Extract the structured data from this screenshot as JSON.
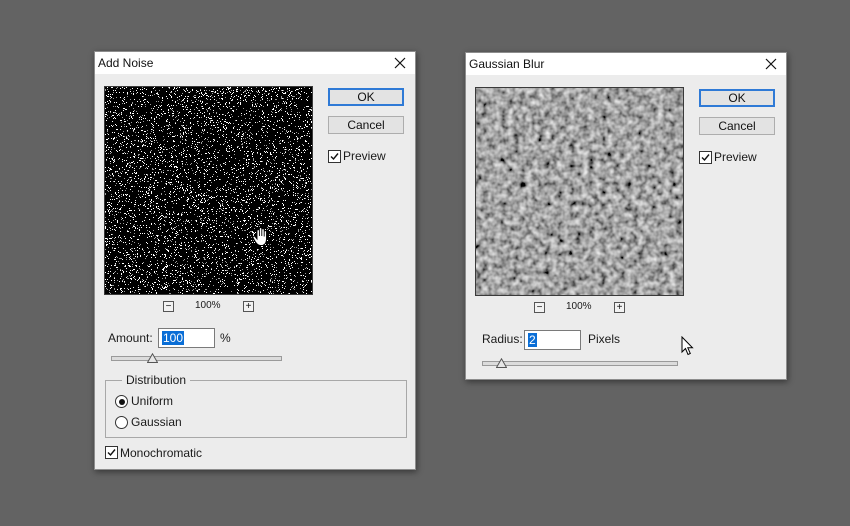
{
  "add_noise": {
    "title": "Add Noise",
    "ok_label": "OK",
    "cancel_label": "Cancel",
    "preview_label": "Preview",
    "preview_checked": true,
    "zoom_label": "100%",
    "zoom_minus": "−",
    "zoom_plus": "+",
    "amount_label": "Amount:",
    "amount_value": "100",
    "amount_unit": "%",
    "amount_slider_fraction": 0.25,
    "distribution_title": "Distribution",
    "distribution_options": [
      "Uniform",
      "Gaussian"
    ],
    "distribution_selected": "Uniform",
    "monochromatic_label": "Monochromatic",
    "monochromatic_checked": true
  },
  "gaussian_blur": {
    "title": "Gaussian Blur",
    "ok_label": "OK",
    "cancel_label": "Cancel",
    "preview_label": "Preview",
    "preview_checked": true,
    "zoom_label": "100%",
    "zoom_minus": "−",
    "zoom_plus": "+",
    "radius_label": "Radius:",
    "radius_value": "2",
    "radius_unit": "Pixels",
    "radius_slider_fraction": 0.1
  },
  "colors": {
    "desktop": "#636363",
    "dialog_bg": "#ececec",
    "default_button_border": "#2f7ad6",
    "selection": "#0a6ed6"
  },
  "icons": [
    "close-icon",
    "checkmark-icon",
    "hand-cursor-icon",
    "arrow-cursor-icon",
    "zoom-out-icon",
    "zoom-in-icon"
  ]
}
